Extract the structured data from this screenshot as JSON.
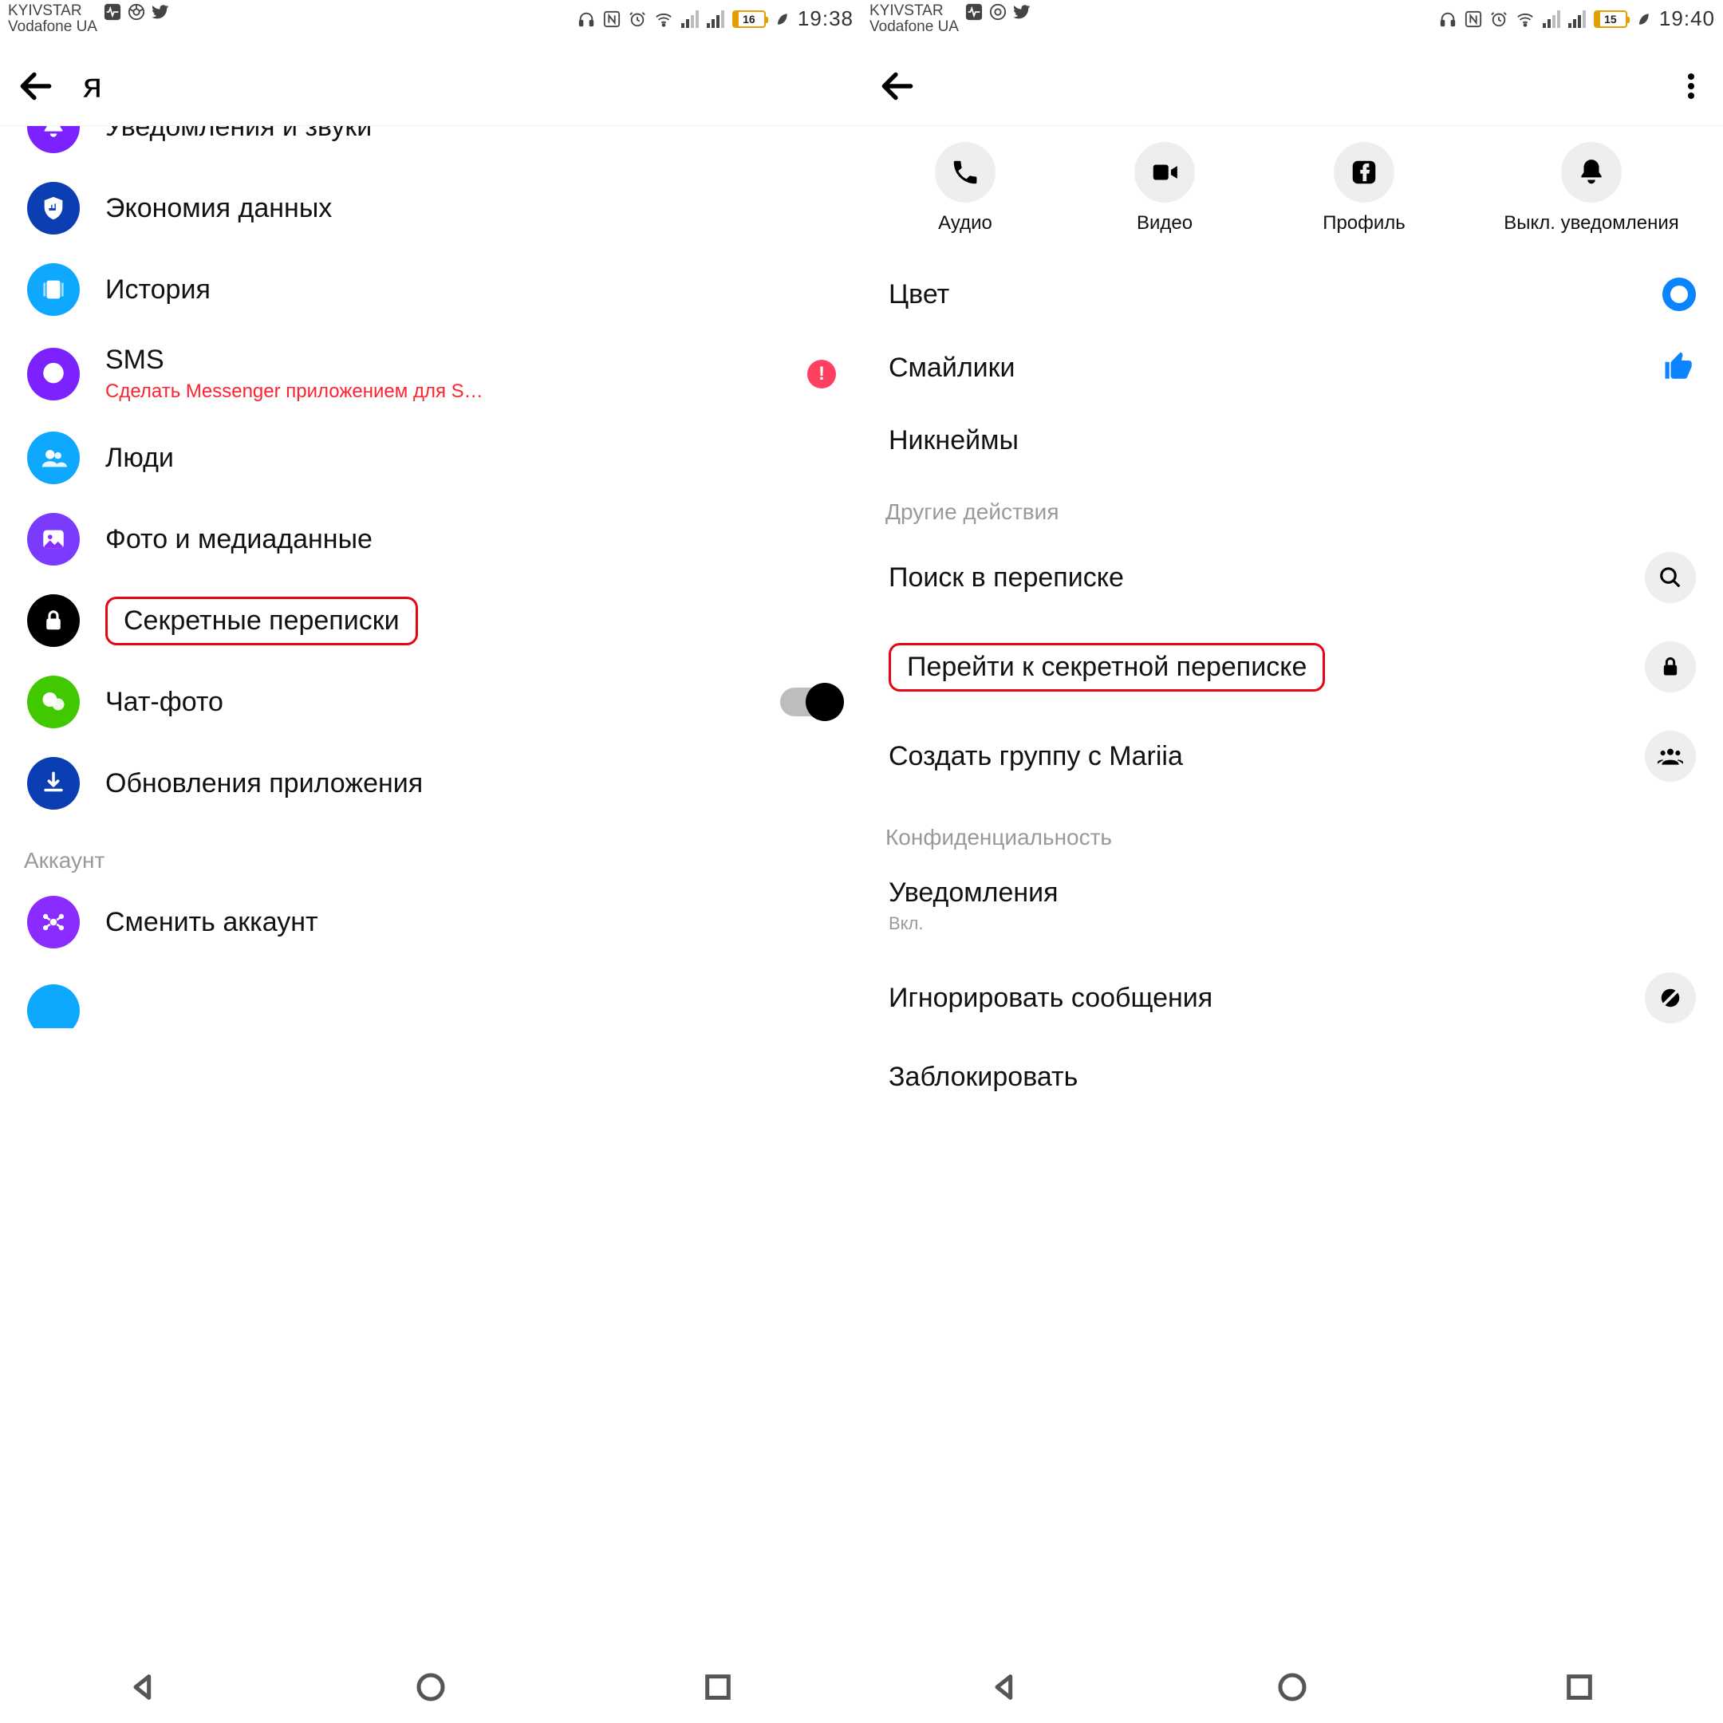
{
  "status": {
    "carrier1": "KYIVSTAR",
    "carrier2": "Vodafone UA",
    "battL": "16",
    "timeL": "19:38",
    "battR": "15",
    "timeR": "19:40"
  },
  "left": {
    "title": "я",
    "rows": {
      "notif": "Уведомления и звуки",
      "data": "Экономия данных",
      "story": "История",
      "sms": "SMS",
      "sms_sub": "Сделать Messenger приложением для S…",
      "people": "Люди",
      "media": "Фото и медиаданные",
      "secret": "Секретные переписки",
      "chatphoto": "Чат-фото",
      "update": "Обновления приложения",
      "section_account": "Аккаунт",
      "switch": "Сменить аккаунт"
    }
  },
  "right": {
    "actions": {
      "audio": "Аудио",
      "video": "Видео",
      "profile": "Профиль",
      "mute": "Выкл. уведомления"
    },
    "opts": {
      "color": "Цвет",
      "emoji": "Смайлики",
      "nick": "Никнеймы",
      "section_other": "Другие действия",
      "search": "Поиск в переписке",
      "secret": "Перейти к секретной переписке",
      "group": "Создать группу с Mariia",
      "section_privacy": "Конфиденциальность",
      "notif": "Уведомления",
      "notif_sub": "Вкл.",
      "ignore": "Игнорировать сообщения",
      "block": "Заблокировать"
    }
  }
}
